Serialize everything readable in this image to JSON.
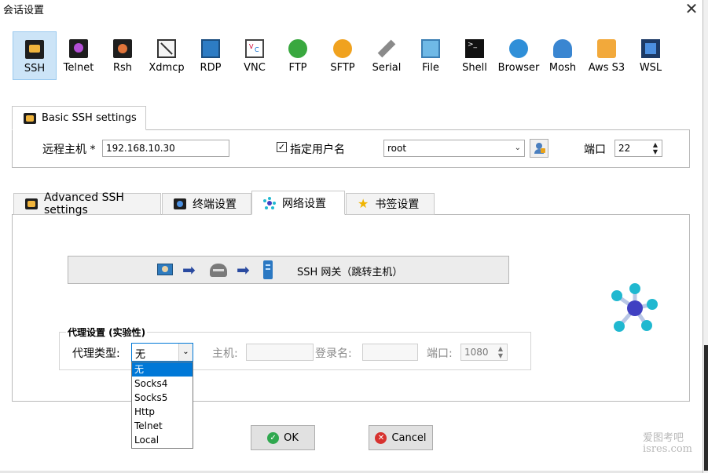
{
  "window": {
    "title": "会话设置",
    "close_glyph": "✕"
  },
  "session_types": [
    {
      "id": "ssh",
      "label": "SSH",
      "icon": "ssh-icon",
      "selected": true
    },
    {
      "id": "telnet",
      "label": "Telnet",
      "icon": "telnet-icon"
    },
    {
      "id": "rsh",
      "label": "Rsh",
      "icon": "rsh-icon"
    },
    {
      "id": "xdmcp",
      "label": "Xdmcp",
      "icon": "xdmcp-icon"
    },
    {
      "id": "rdp",
      "label": "RDP",
      "icon": "rdp-icon"
    },
    {
      "id": "vnc",
      "label": "VNC",
      "icon": "vnc-icon"
    },
    {
      "id": "ftp",
      "label": "FTP",
      "icon": "ftp-icon"
    },
    {
      "id": "sftp",
      "label": "SFTP",
      "icon": "sftp-icon"
    },
    {
      "id": "serial",
      "label": "Serial",
      "icon": "serial-icon"
    },
    {
      "id": "file",
      "label": "File",
      "icon": "file-icon"
    },
    {
      "id": "shell",
      "label": "Shell",
      "icon": "shell-icon"
    },
    {
      "id": "browser",
      "label": "Browser",
      "icon": "browser-icon"
    },
    {
      "id": "mosh",
      "label": "Mosh",
      "icon": "mosh-icon"
    },
    {
      "id": "awss3",
      "label": "Aws S3",
      "icon": "aws-s3-icon"
    },
    {
      "id": "wsl",
      "label": "WSL",
      "icon": "wsl-icon"
    }
  ],
  "basic": {
    "tab_label": "Basic SSH settings",
    "remote_host_label": "远程主机 *",
    "remote_host_value": "192.168.10.30",
    "specify_user_label": "指定用户名",
    "specify_user_checked": true,
    "username_value": "root",
    "port_label": "端口",
    "port_value": "22"
  },
  "adv_tabs": [
    {
      "label": "Advanced SSH settings",
      "icon": "wrench-icon"
    },
    {
      "label": "终端设置",
      "icon": "terminal-icon"
    },
    {
      "label": "网络设置",
      "icon": "network-icon",
      "active": true
    },
    {
      "label": "书签设置",
      "icon": "star-icon"
    }
  ],
  "network": {
    "gateway_label": "SSH 网关（跳转主机）",
    "proxy_group_label": "代理设置 (实验性)",
    "proxy_type_label": "代理类型:",
    "proxy_type_value": "无",
    "proxy_options": [
      "无",
      "Socks4",
      "Socks5",
      "Http",
      "Telnet",
      "Local"
    ],
    "host_label": "主机:",
    "login_label": "登录名:",
    "port_label": "端口:",
    "port_value": "1080"
  },
  "buttons": {
    "ok": "OK",
    "cancel": "Cancel"
  },
  "watermark": {
    "line1": "爱图考吧",
    "line2": "isres.com"
  },
  "colors": {
    "selection": "#0078d7",
    "tool_selected_bg": "#cce4f7"
  }
}
